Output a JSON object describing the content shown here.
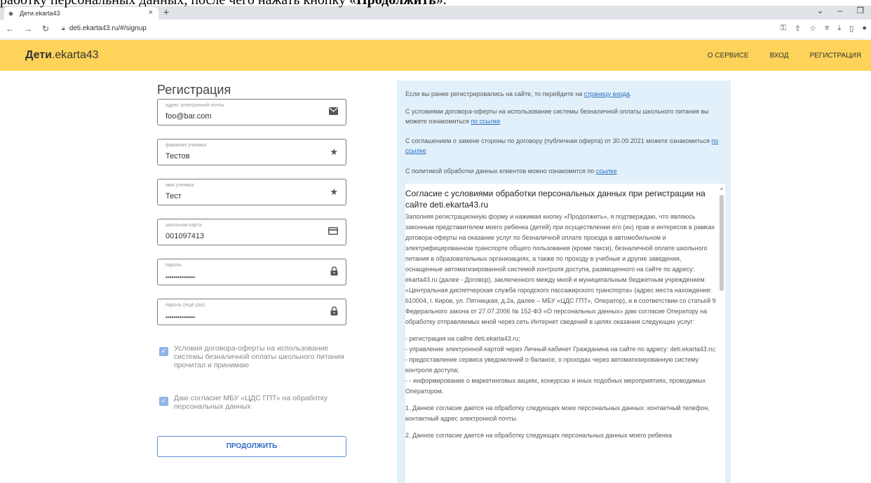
{
  "caption": {
    "prefix": "работку персональных данных, после чего нажать кнопку «",
    "button": "Продолжить",
    "suffix": "»."
  },
  "browser": {
    "tab_title": "Дети.ekarta43",
    "url": "deti.ekarta43.ru/#/signup"
  },
  "site": {
    "logo_bold": "Дети",
    "logo_rest": ".ekarta43",
    "nav": [
      "О СЕРВИСЕ",
      "ВХОД",
      "РЕГИСТРАЦИЯ"
    ]
  },
  "form": {
    "title": "Регистрация",
    "fields": [
      {
        "label": "адрес электронной почты",
        "value": "foo@bar.com",
        "icon": "envelope-icon"
      },
      {
        "label": "фамилия ученика",
        "value": "Тестов",
        "icon": "star-icon"
      },
      {
        "label": "имя ученика",
        "value": "Тест",
        "icon": "star-icon"
      },
      {
        "label": "школьная карта",
        "value": "001097413",
        "icon": "card-icon"
      },
      {
        "label": "пароль",
        "value": "•••••••••••••••",
        "icon": "lock-icon"
      },
      {
        "label": "пароль (ещё раз)",
        "value": "•••••••••••••••",
        "icon": "lock-icon"
      }
    ],
    "checks": [
      {
        "label": "Условия договора-оферты на использование системы безналичной оплаты школьного питания прочитал и принимаю",
        "checked": true
      },
      {
        "label": "Даю согласие МБУ «ЦДС ГПТ» на обработку персональных данных",
        "checked": true
      }
    ],
    "submit_label": "ПРОДОЛЖИТЬ"
  },
  "info": {
    "p1_text": "Если вы ранее регистрировались на сайте, то перейдите на ",
    "p1_link": "страницу входа",
    "p1_end": ".",
    "p2_text": "С условиями договора-оферты на использование системы безналичной оплаты школьного питания вы можете ознакомиться ",
    "p2_link": "по ссылке",
    "p3_text": "С соглашением о замене стороны по договору (публичная оферта) от 30.09.2021 можете ознакомиться ",
    "p3_link": "по ссылке",
    "p4_text": "С политикой обработки данных клиентов можно ознакомится по ",
    "p4_link": "ссылке"
  },
  "agreement": {
    "title": "Согласие с условиями обработки персональных данных при регистрации на сайте deti.ekarta43.ru",
    "body": "Заполняя регистрационную форму и нажимая кнопку «Продолжить», я подтверждаю, что являюсь законным представителем моего ребенка (детей) при осуществлении его (их) прав и интересов в рамках договора-оферты на оказание услуг по безналичной оплате проезда в автомобильном и электрифицированном транспорте общего пользования (кроме такси), безналичной оплате школьного питания в образовательных организациях, а также по проходу в учебные и другие заведения, оснащенные автоматизированной системой контроля доступа, размещенного на сайте по адресу: ekarta43.ru (далее - Договор), заключенного между мной и муниципальным бюджетным учреждением «Центральная диспетчерская служба городского пассажирского транспорта» (адрес места нахождения: 610004, г. Киров, ул. Пятницкая, д.2а, далее – МБУ «ЦДС ГПТ», Оператор), и в соответствии со статьей 9 Федерального закона от 27.07.2006 № 152-ФЗ «О персональных данных» даю согласие Оператору на обработку отправляемых мной через сеть Интернет сведений в целях оказания следующих услуг:",
    "list": [
      "- регистрация на сайте deti.ekarta43.ru;",
      "- управление электронной картой через Личный кабинет Гражданина на сайте по адресу: deti.ekarta43.ru;",
      "- предоставление сервиса уведомлений о балансе, о проходах через автоматизированную систему контроля доступа;",
      "- - информирование о маркетинговых акциях, конкурсах и иных подобных мероприятиях, проводимых Оператором."
    ],
    "item1": "1. Данное согласие дается на обработку следующих моих персональных данных: контактный телефон, контактный адрес электронной почты.",
    "item2": "2. Данное согласие дается на обработку следующих персональных данных моего ребенка"
  }
}
